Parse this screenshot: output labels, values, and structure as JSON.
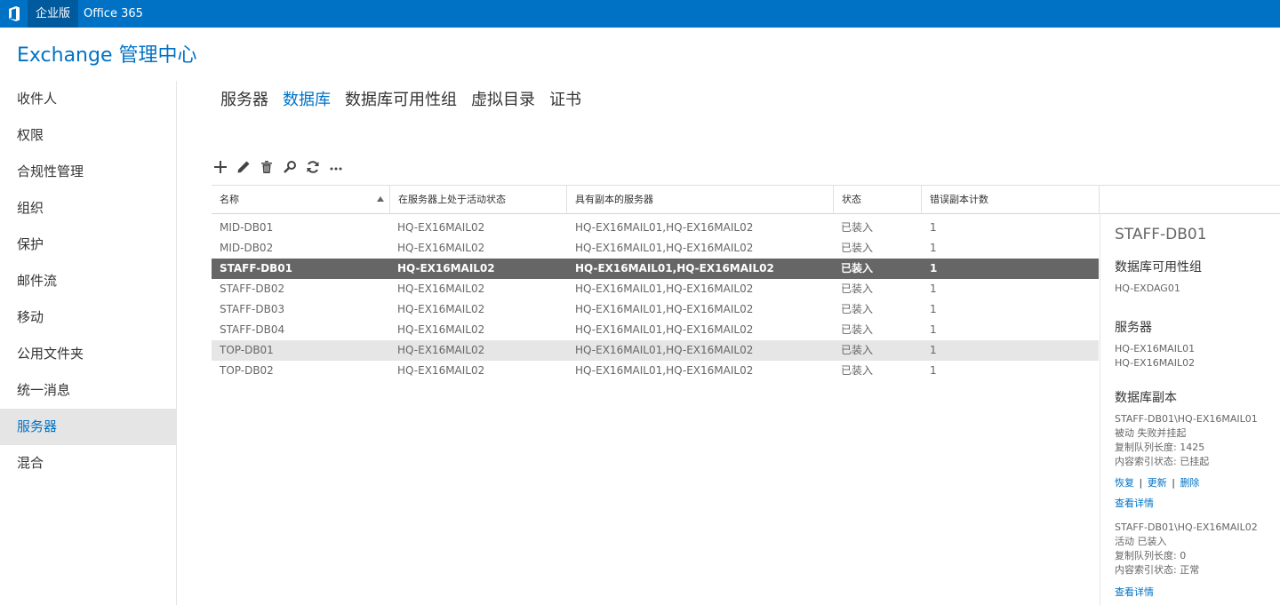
{
  "topbar": {
    "logo_icon": "office-logo-icon",
    "edition": "企业版",
    "product": "Office 365",
    "accent": "#0072c6"
  },
  "app_title": "Exchange 管理中心",
  "nav": {
    "items": [
      {
        "label": "收件人"
      },
      {
        "label": "权限"
      },
      {
        "label": "合规性管理"
      },
      {
        "label": "组织"
      },
      {
        "label": "保护"
      },
      {
        "label": "邮件流"
      },
      {
        "label": "移动"
      },
      {
        "label": "公用文件夹"
      },
      {
        "label": "统一消息"
      },
      {
        "label": "服务器",
        "selected": true
      },
      {
        "label": "混合"
      }
    ]
  },
  "tabs": [
    {
      "label": "服务器"
    },
    {
      "label": "数据库",
      "active": true
    },
    {
      "label": "数据库可用性组"
    },
    {
      "label": "虚拟目录"
    },
    {
      "label": "证书"
    }
  ],
  "toolbar": [
    "add-icon",
    "edit-icon",
    "delete-icon",
    "search-icon",
    "refresh-icon",
    "more-icon"
  ],
  "table": {
    "columns": [
      "名称",
      "在服务器上处于活动状态",
      "具有副本的服务器",
      "状态",
      "错误副本计数"
    ],
    "sort_column": "名称",
    "rows": [
      [
        "MID-DB01",
        "HQ-EX16MAIL02",
        "HQ-EX16MAIL01,HQ-EX16MAIL02",
        "已装入",
        "1"
      ],
      [
        "MID-DB02",
        "HQ-EX16MAIL02",
        "HQ-EX16MAIL01,HQ-EX16MAIL02",
        "已装入",
        "1"
      ],
      [
        "STAFF-DB01",
        "HQ-EX16MAIL02",
        "HQ-EX16MAIL01,HQ-EX16MAIL02",
        "已装入",
        "1"
      ],
      [
        "STAFF-DB02",
        "HQ-EX16MAIL02",
        "HQ-EX16MAIL01,HQ-EX16MAIL02",
        "已装入",
        "1"
      ],
      [
        "STAFF-DB03",
        "HQ-EX16MAIL02",
        "HQ-EX16MAIL01,HQ-EX16MAIL02",
        "已装入",
        "1"
      ],
      [
        "STAFF-DB04",
        "HQ-EX16MAIL02",
        "HQ-EX16MAIL01,HQ-EX16MAIL02",
        "已装入",
        "1"
      ],
      [
        "TOP-DB01",
        "HQ-EX16MAIL02",
        "HQ-EX16MAIL01,HQ-EX16MAIL02",
        "已装入",
        "1"
      ],
      [
        "TOP-DB02",
        "HQ-EX16MAIL02",
        "HQ-EX16MAIL01,HQ-EX16MAIL02",
        "已装入",
        "1"
      ]
    ],
    "selected_row": 2,
    "hover_row": 6
  },
  "details": {
    "title": "STAFF-DB01",
    "dag_heading": "数据库可用性组",
    "dag_value": "HQ-EXDAG01",
    "servers_heading": "服务器",
    "servers": [
      "HQ-EX16MAIL01",
      "HQ-EX16MAIL02"
    ],
    "copies_heading": "数据库副本",
    "copy1": {
      "name": "STAFF-DB01\\HQ-EX16MAIL01",
      "status": " 被动 失败并挂起",
      "queue": "复制队列长度:  1425",
      "index": "内容索引状态:  已挂起",
      "link_resume": "恢复",
      "link_update": "更新",
      "link_delete": "删除",
      "sep": "|",
      "link_details": "查看详情"
    },
    "copy2": {
      "name": "STAFF-DB01\\HQ-EX16MAIL02",
      "status": " 活动 已装入",
      "queue": "复制队列长度:  0",
      "index": "内容索引状态:  正常",
      "link_details": "查看详情"
    }
  }
}
